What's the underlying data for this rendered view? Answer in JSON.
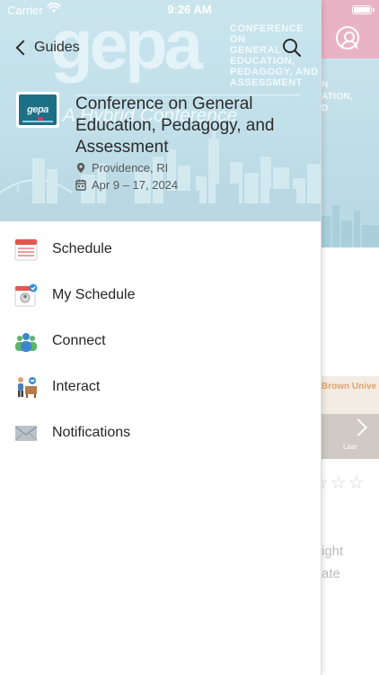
{
  "status_bar": {
    "carrier": "Carrier",
    "time": "9:26 AM"
  },
  "nav": {
    "back_label": "Guides"
  },
  "header": {
    "watermark_logo": "gepa",
    "watermark_side": [
      "CONFERENCE ON",
      "GENERAL EDUCATION,",
      "PEDAGOGY, AND",
      "ASSESSMENT"
    ],
    "watermark_script": "A Hybrid Conference"
  },
  "event": {
    "logo_text": "gepa",
    "title": "Conference on General Education, Pedagogy, and Assessment",
    "location": "Providence, RI",
    "dates": "Apr 9 – 17, 2024"
  },
  "menu": {
    "items": [
      {
        "label": "Schedule",
        "icon": "calendar-icon"
      },
      {
        "label": "My Schedule",
        "icon": "my-schedule-icon"
      },
      {
        "label": "Connect",
        "icon": "people-icon"
      },
      {
        "label": "Interact",
        "icon": "interact-icon"
      },
      {
        "label": "Notifications",
        "icon": "envelope-icon"
      }
    ]
  },
  "background_page": {
    "hero_text": [
      "N",
      "ATION,",
      "D"
    ],
    "banner_text": "Brown Unive",
    "banner_small": "Lear",
    "lines": [
      "ight",
      "ate"
    ]
  },
  "colors": {
    "header_bg": "#c2e0ea",
    "accent_pink": "#e9b3c6",
    "calendar_red": "#e0574f",
    "badge_blue": "#3a8fd8",
    "people_green": "#5db46b",
    "people_blue": "#3d86cf"
  }
}
